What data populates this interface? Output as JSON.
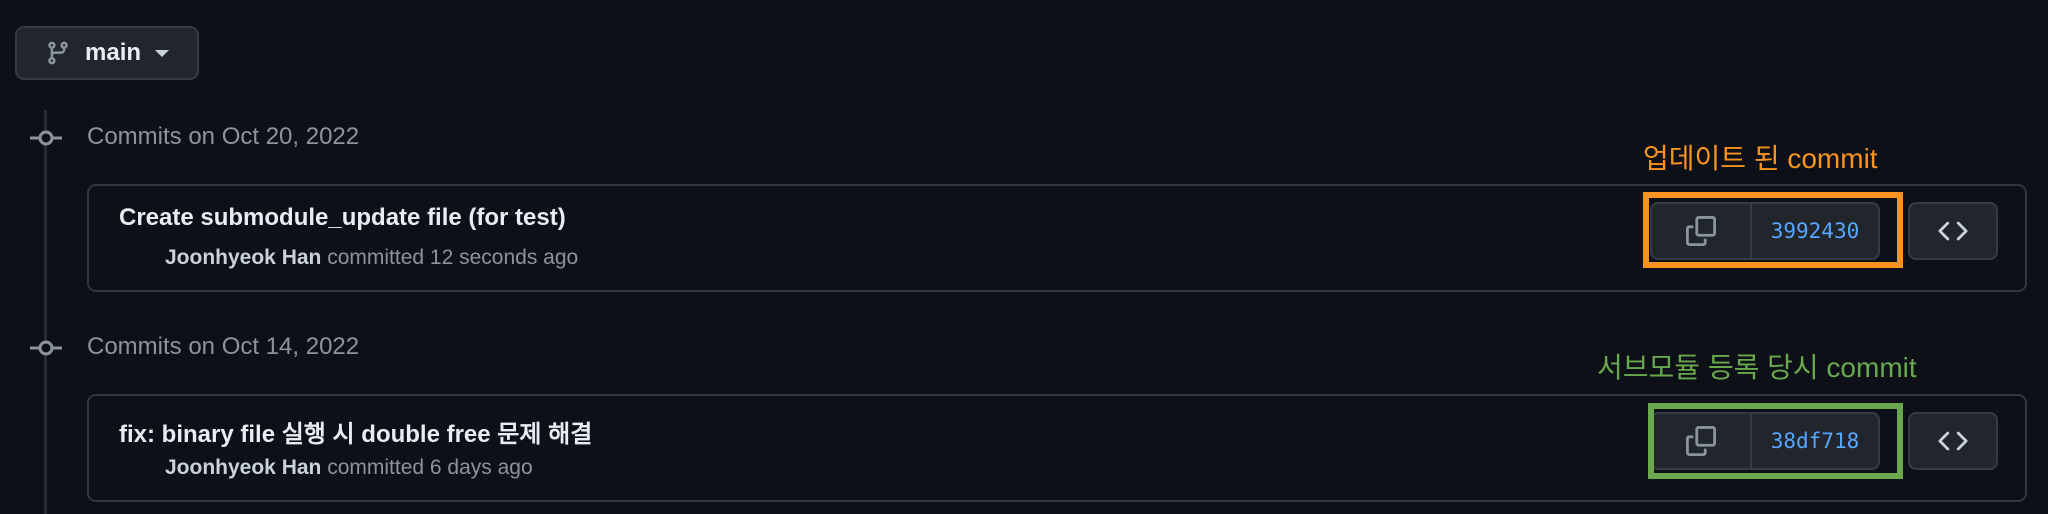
{
  "branch": {
    "label": "main",
    "icon": "git-branch-icon"
  },
  "colors": {
    "background": "#0d1117",
    "sha_link": "#58a6ff",
    "annotation_orange": "#f7931e",
    "annotation_green": "#6aa84f"
  },
  "groups": [
    {
      "heading": "Commits on Oct 20, 2022",
      "commit": {
        "title": "Create submodule_update file (for test)",
        "author": "Joonhyeok Han",
        "action": "committed",
        "time": "12 seconds ago",
        "sha": "3992430"
      },
      "annotation": {
        "text": "업데이트 된 commit",
        "color": "#f7931e"
      }
    },
    {
      "heading": "Commits on Oct 14, 2022",
      "commit": {
        "title": "fix: binary file 실행 시 double free 문제 해결",
        "author": "Joonhyeok Han",
        "action": "committed",
        "time": "6 days ago",
        "sha": "38df718"
      },
      "annotation": {
        "text": "서브모듈 등록 당시 commit",
        "color": "#6aa84f"
      }
    }
  ]
}
